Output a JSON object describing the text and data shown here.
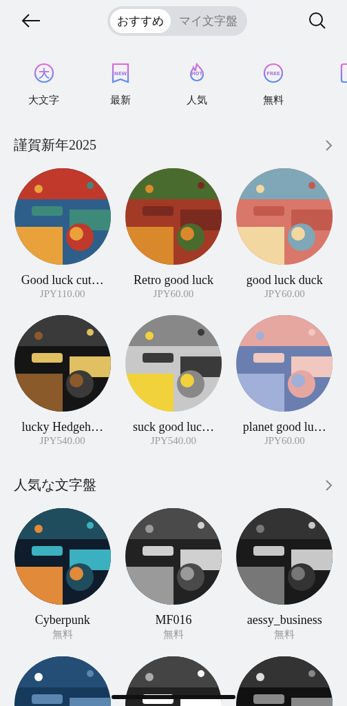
{
  "header": {
    "tabs": [
      {
        "label": "おすすめ",
        "selected": true
      },
      {
        "label": "マイ文字盤",
        "selected": false
      }
    ]
  },
  "categories": [
    {
      "badge": "大",
      "label": "大文字",
      "kind": "circle"
    },
    {
      "badge": "NEW",
      "label": "最新",
      "kind": "banner"
    },
    {
      "badge": "HOT",
      "label": "人気",
      "kind": "flame"
    },
    {
      "badge": "FREE",
      "label": "無料",
      "kind": "circle"
    }
  ],
  "sections": [
    {
      "title": "謹賀新年2025",
      "items": [
        {
          "kind": "face",
          "name": "Good luck cut…",
          "price": "JPY110.00"
        },
        {
          "kind": "face",
          "name": "Retro good luck",
          "price": "JPY60.00"
        },
        {
          "kind": "face",
          "name": "good luck duck",
          "price": "JPY60.00"
        },
        {
          "kind": "face",
          "name": "lucky Hedgeh…",
          "price": "JPY540.00"
        },
        {
          "kind": "face",
          "name": "suck good luc…",
          "price": "JPY540.00"
        },
        {
          "kind": "face",
          "name": "planet good lu…",
          "price": "JPY60.00"
        }
      ]
    },
    {
      "title": "人気な文字盤",
      "items": [
        {
          "kind": "face",
          "name": "Cyberpunk",
          "price": "無料"
        },
        {
          "kind": "face",
          "name": "MF016",
          "price": "無料"
        },
        {
          "kind": "face",
          "name": "aessy_business",
          "price": "無料"
        },
        {
          "kind": "picture"
        },
        {
          "kind": "picture"
        },
        {
          "kind": "picture"
        }
      ]
    }
  ]
}
